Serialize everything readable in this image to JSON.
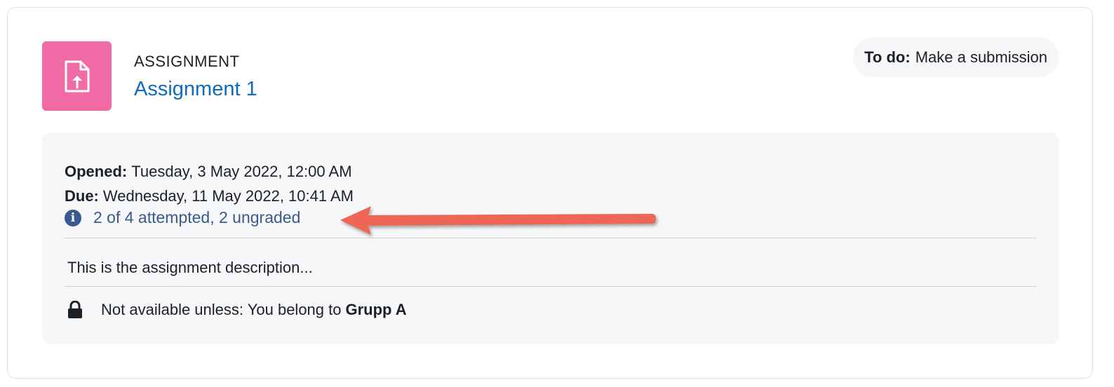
{
  "activity": {
    "type_label": "ASSIGNMENT",
    "name": "Assignment 1",
    "icon": "assignment-upload-icon",
    "icon_color": "#f06aa6"
  },
  "todo": {
    "label": "To do:",
    "text": "Make a submission"
  },
  "dates": {
    "opened_label": "Opened:",
    "opened_value": "Tuesday, 3 May 2022, 12:00 AM",
    "due_label": "Due:",
    "due_value": "Wednesday, 11 May 2022, 10:41 AM"
  },
  "completion": {
    "icon": "info-icon",
    "text": "2 of 4 attempted, 2 ungraded"
  },
  "description": "This is the assignment description...",
  "restriction": {
    "icon": "lock-icon",
    "text": "Not available unless: You belong to",
    "group": "Grupp A"
  },
  "colors": {
    "link": "#0f6cbf",
    "completion_text": "#3a5a8e",
    "annotation_arrow": "#ee6655"
  }
}
